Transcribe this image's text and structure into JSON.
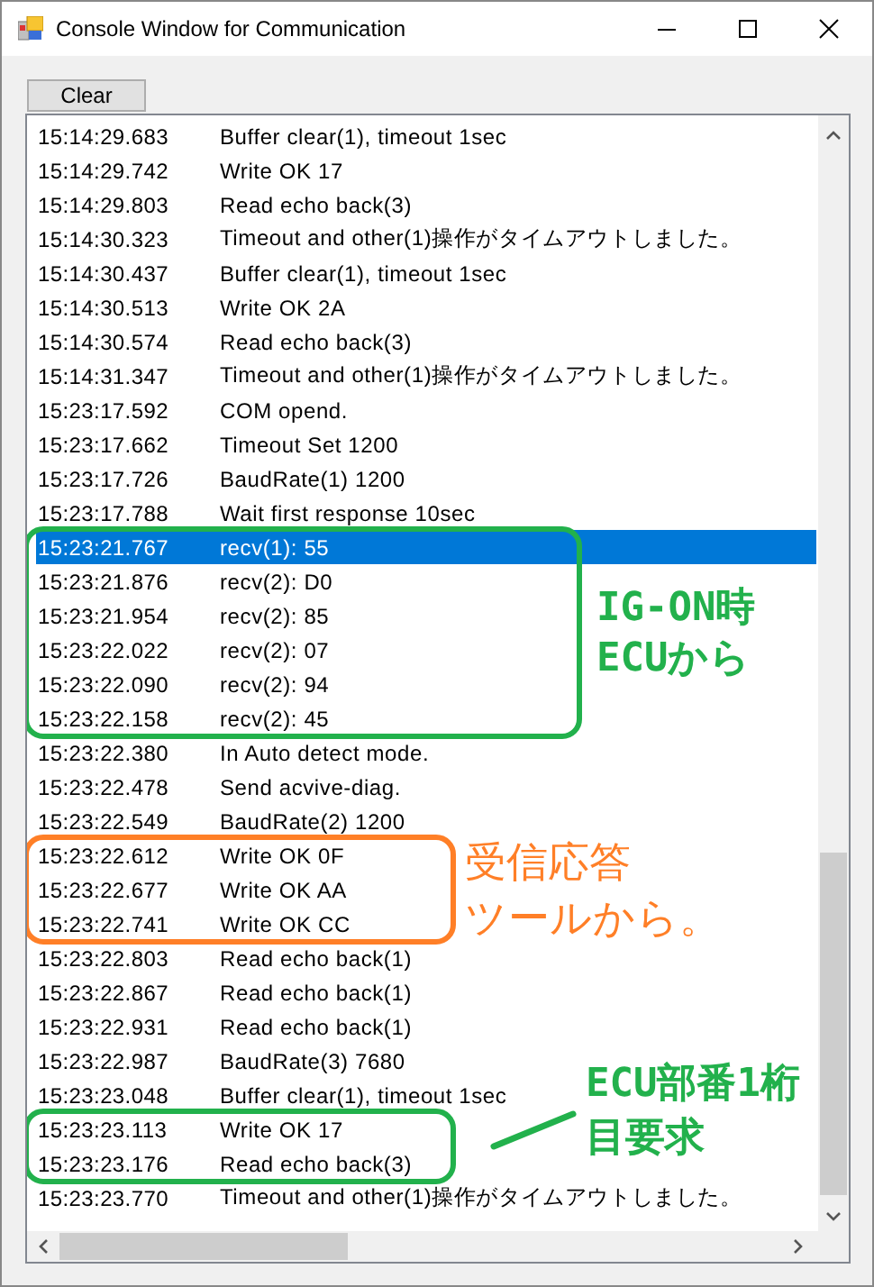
{
  "window": {
    "title": "Console Window for Communication"
  },
  "clear_button": "Clear",
  "log": [
    {
      "rows": [
        {
          "time": "15:14:29.683",
          "message": "Buffer clear(1), timeout 1sec",
          "selected": false
        },
        {
          "time": "15:14:29.742",
          "message": "Write OK 17",
          "selected": false
        },
        {
          "time": "15:14:29.803",
          "message": "Read echo back(3)",
          "selected": false
        },
        {
          "time": "15:14:30.323",
          "message": "Timeout and other(1)操作がタイムアウトしました。",
          "selected": false
        },
        {
          "time": "15:14:30.437",
          "message": "Buffer clear(1), timeout 1sec",
          "selected": false
        },
        {
          "time": "15:14:30.513",
          "message": "Write OK 2A",
          "selected": false
        },
        {
          "time": "15:14:30.574",
          "message": "Read echo back(3)",
          "selected": false
        },
        {
          "time": "15:14:31.347",
          "message": "Timeout and other(1)操作がタイムアウトしました。",
          "selected": false
        },
        {
          "time": "15:23:17.592",
          "message": "COM opend.",
          "selected": false
        },
        {
          "time": "15:23:17.662",
          "message": "Timeout Set 1200",
          "selected": false
        },
        {
          "time": "15:23:17.726",
          "message": "BaudRate(1) 1200",
          "selected": false
        },
        {
          "time": "15:23:17.788",
          "message": "Wait first response 10sec",
          "selected": false
        }
      ]
    },
    {
      "color": "#22b14c",
      "kind": "note",
      "note": [
        "IG-ON時",
        "ECUから"
      ],
      "rows": [
        {
          "time": "15:23:21.767",
          "message": "recv(1): 55",
          "selected": true
        },
        {
          "time": "15:23:21.876",
          "message": "recv(2): D0",
          "selected": false
        },
        {
          "time": "15:23:21.954",
          "message": "recv(2): 85",
          "selected": false
        },
        {
          "time": "15:23:22.022",
          "message": "recv(2): 07",
          "selected": false
        },
        {
          "time": "15:23:22.090",
          "message": "recv(2): 94",
          "selected": false
        },
        {
          "time": "15:23:22.158",
          "message": "recv(2): 45",
          "selected": false
        }
      ]
    },
    {
      "rows": [
        {
          "time": "15:23:22.380",
          "message": "In Auto detect mode.",
          "selected": false
        },
        {
          "time": "15:23:22.478",
          "message": "Send acvive-diag.",
          "selected": false
        },
        {
          "time": "15:23:22.549",
          "message": "BaudRate(2) 1200",
          "selected": false
        }
      ]
    },
    {
      "color": "#ff7f27",
      "kind": "note",
      "note": [
        "受信応答",
        "ツールから。"
      ],
      "rows": [
        {
          "time": "15:23:22.612",
          "message": "Write OK 0F",
          "selected": false
        },
        {
          "time": "15:23:22.677",
          "message": "Write OK AA",
          "selected": false
        },
        {
          "time": "15:23:22.741",
          "message": "Write OK CC",
          "selected": false
        }
      ]
    },
    {
      "rows": [
        {
          "time": "15:23:22.803",
          "message": "Read echo back(1)",
          "selected": false
        },
        {
          "time": "15:23:22.867",
          "message": "Read echo back(1)",
          "selected": false
        },
        {
          "time": "15:23:22.931",
          "message": "Read echo back(1)",
          "selected": false
        },
        {
          "time": "15:23:22.987",
          "message": "BaudRate(3) 7680",
          "selected": false
        },
        {
          "time": "15:23:23.048",
          "message": "Buffer clear(1), timeout 1sec",
          "selected": false
        }
      ]
    },
    {
      "color": "#22b14c",
      "kind": "leader-note",
      "note": [
        "ECU部番1桁",
        "目要求"
      ],
      "rows": [
        {
          "time": "15:23:23.113",
          "message": "Write OK 17",
          "selected": false
        },
        {
          "time": "15:23:23.176",
          "message": "Read echo back(3)",
          "selected": false
        }
      ]
    },
    {
      "rows": [
        {
          "time": "15:23:23.770",
          "message": "Timeout and other(1)操作がタイムアウトしました。",
          "selected": false
        }
      ]
    }
  ]
}
